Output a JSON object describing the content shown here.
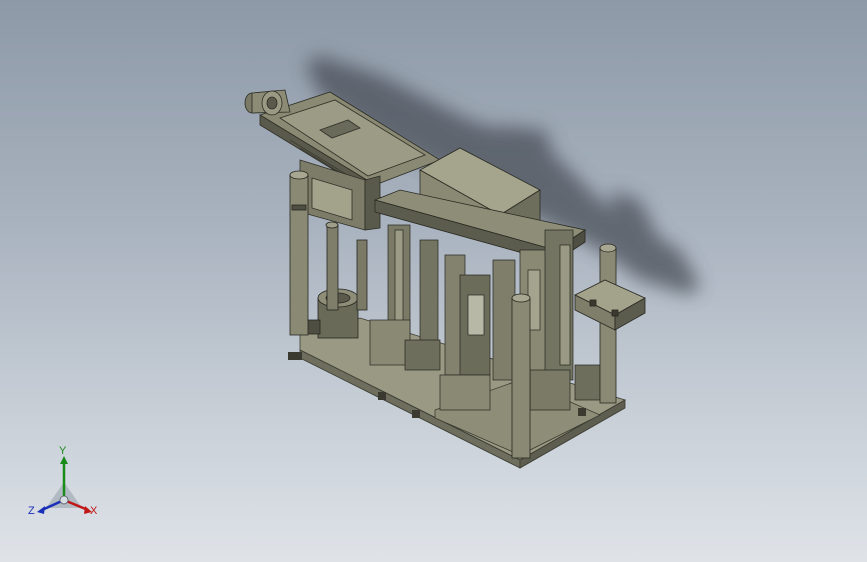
{
  "viewport": {
    "model": "assembly-isometric-view",
    "background": [
      "#8e99a8",
      "#dfe3e8"
    ]
  },
  "triad": {
    "x_label": "X",
    "y_label": "Y",
    "z_label": "Z",
    "colors": {
      "x": "#c01818",
      "y": "#1a8a1a",
      "z": "#1a2fb8"
    }
  }
}
